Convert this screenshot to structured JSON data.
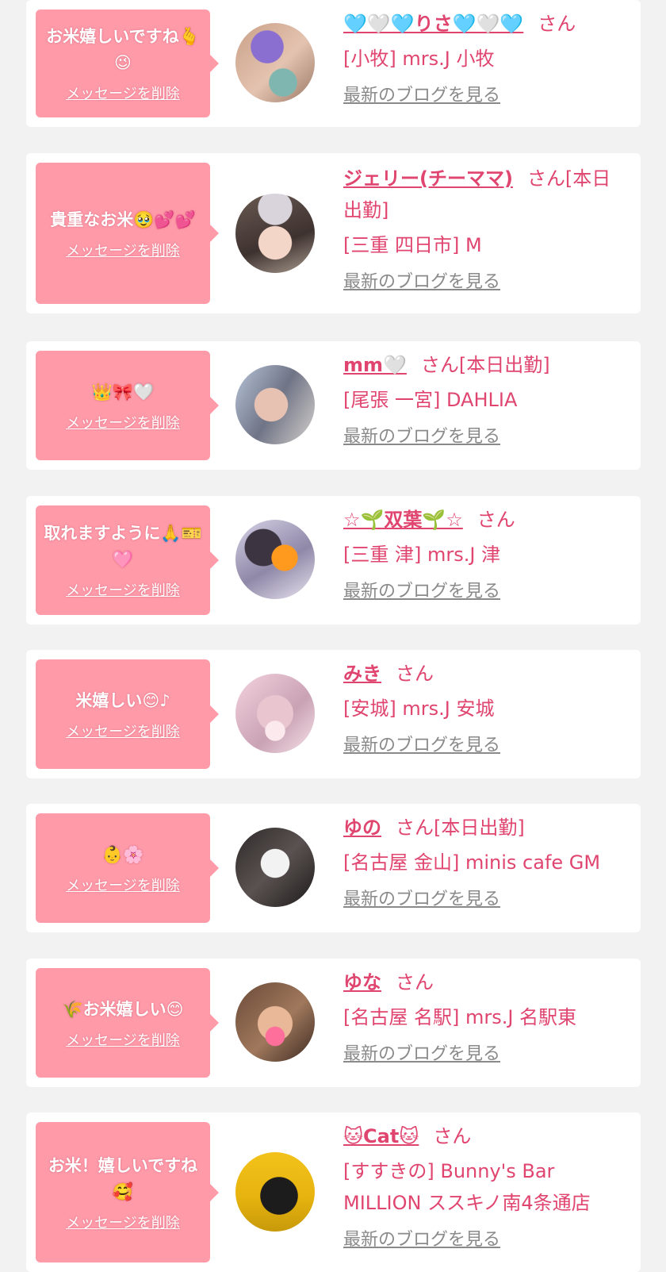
{
  "items": [
    {
      "message": "お米嬉しいですね🫰😉",
      "delete_label": "メッセージを削除",
      "name": "🩵🤍🩵りさ🩵🤍🩵",
      "suffix": "さん",
      "shop": "[小牧] mrs.J 小牧",
      "blog_label": "最新のブログを見る"
    },
    {
      "message": "貴重なお米🥹💕💕",
      "delete_label": "メッセージを削除",
      "name": "ジェリー(チーママ)",
      "suffix": "さん[本日出勤]",
      "shop": "[三重 四日市] M",
      "blog_label": "最新のブログを見る"
    },
    {
      "message": "👑🎀🤍",
      "delete_label": "メッセージを削除",
      "name": "mm🤍",
      "suffix": "さん[本日出勤]",
      "shop": "[尾張 一宮] DAHLIA",
      "blog_label": "最新のブログを見る"
    },
    {
      "message": "取れますように🙏🎫🩷",
      "delete_label": "メッセージを削除",
      "name": "☆🌱双葉🌱☆",
      "suffix": "さん",
      "shop": "[三重 津] mrs.J 津",
      "blog_label": "最新のブログを見る"
    },
    {
      "message": "米嬉しい😊♪",
      "delete_label": "メッセージを削除",
      "name": "みき",
      "suffix": "さん",
      "shop": "[安城] mrs.J 安城",
      "blog_label": "最新のブログを見る"
    },
    {
      "message": "👶🌸",
      "delete_label": "メッセージを削除",
      "name": "ゆの",
      "suffix": "さん[本日出勤]",
      "shop": "[名古屋 金山] minis cafe GM",
      "blog_label": "最新のブログを見る"
    },
    {
      "message": "🌾お米嬉しい😊",
      "delete_label": "メッセージを削除",
      "name": "ゆな",
      "suffix": "さん",
      "shop": "[名古屋 名駅] mrs.J 名駅東",
      "blog_label": "最新のブログを見る"
    },
    {
      "message": "お米！嬉しいですね🥰",
      "delete_label": "メッセージを削除",
      "name": "🐱Cat🐱",
      "suffix": "さん",
      "shop": "[すすきの] Bunny's Bar MILLION ススキノ南4条通店",
      "blog_label": "最新のブログを見る"
    }
  ],
  "colors": {
    "background": "#f2f2f2",
    "card": "#ffffff",
    "bubble": "#ff9aa9",
    "accent": "#e0456f",
    "muted": "#8a8a8a"
  }
}
